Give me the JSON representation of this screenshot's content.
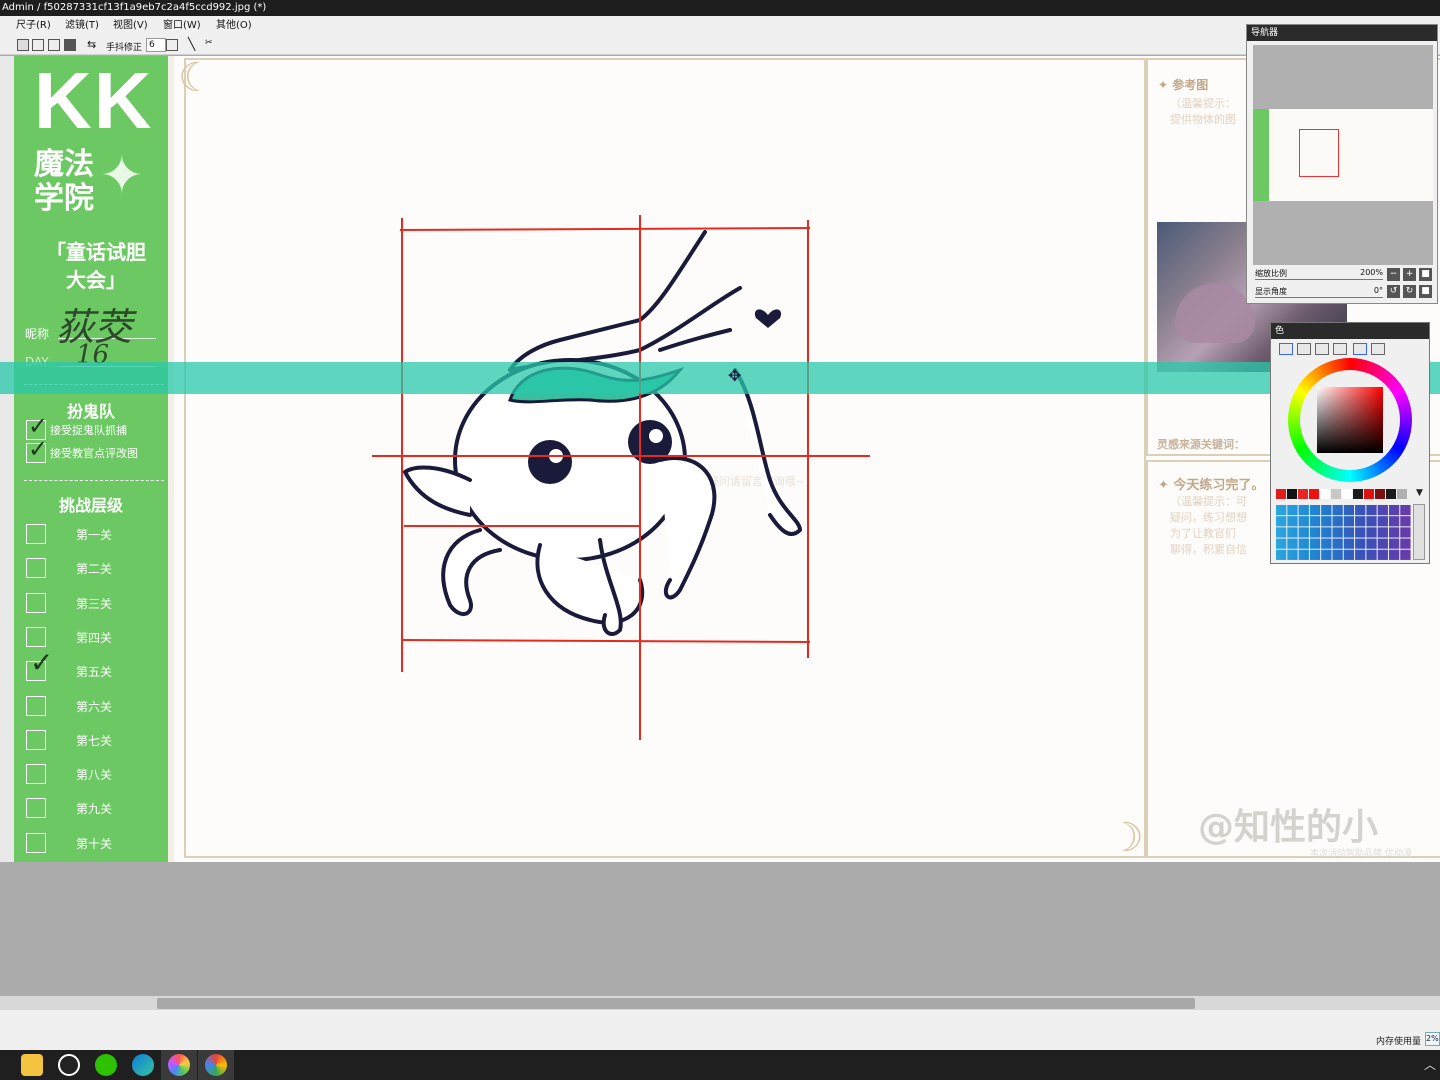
{
  "window": {
    "title": "Admin / f50287331cf13f1a9eb7c2a4f5ccd992.jpg (*)"
  },
  "menu": {
    "items": [
      "尺子(R)",
      "滤镜(T)",
      "视图(V)",
      "窗口(W)",
      "其他(O)"
    ]
  },
  "toolbar": {
    "stabilizer_label": "手抖修正",
    "stabilizer_value": "6"
  },
  "artwork": {
    "logo": "KK",
    "academy": "魔法学院",
    "event": "「童话试胆大会」",
    "nickname_label": "昵称",
    "nickname_value": "荻茭",
    "day_label": "DAY",
    "day_value": "16",
    "ghost_team": {
      "title": "扮鬼队",
      "items": [
        "接受捉鬼队抓捕",
        "接受教官点评改图"
      ]
    },
    "levels": {
      "title": "挑战层级",
      "items": [
        {
          "label": "第一关",
          "checked": false
        },
        {
          "label": "第二关",
          "checked": false
        },
        {
          "label": "第三关",
          "checked": false
        },
        {
          "label": "第四关",
          "checked": false
        },
        {
          "label": "第五关",
          "checked": true
        },
        {
          "label": "第六关",
          "checked": false
        },
        {
          "label": "第七关",
          "checked": false
        },
        {
          "label": "第八关",
          "checked": false
        },
        {
          "label": "第九关",
          "checked": false
        },
        {
          "label": "第十关",
          "checked": false
        }
      ]
    },
    "reference_title": "参考图",
    "reference_hint": "（温馨提示：\n提供物体的图",
    "inspiration_label": "灵感来源关键词：",
    "practice_title": "今天练习完了。",
    "practice_hint": "（温馨提示：可\n疑问，练习想想\n为了让教官们\n聊得，积累自信",
    "center_hint": "(可以作为上色时... 设法：请贴一张照片作为 ... 若有疑问请留言咨询哦~)",
    "watermark": "@知性的小",
    "watermark_sub": "本次活动暂助品牌 优动漫"
  },
  "navigator": {
    "title": "导航器",
    "zoom_label": "缩放比例",
    "zoom_value": "200%",
    "angle_label": "显示角度",
    "angle_value": "0°"
  },
  "color_panel": {
    "title": "色",
    "swatches": [
      "#e21b1b",
      "#111111",
      "#e32626",
      "#f11010",
      "#ffffff",
      "#c8c8c8",
      "#ffffff",
      "#1c1c1c",
      "#e01010",
      "#7a1010",
      "#1a1a1a",
      "#b0b0b0"
    ]
  },
  "status": {
    "memory_label": "内存使用量",
    "memory_value": "2%"
  },
  "taskbar": {
    "apps": [
      "file-explorer",
      "qq",
      "wechat",
      "edge",
      "paint-app",
      "chrome"
    ]
  }
}
